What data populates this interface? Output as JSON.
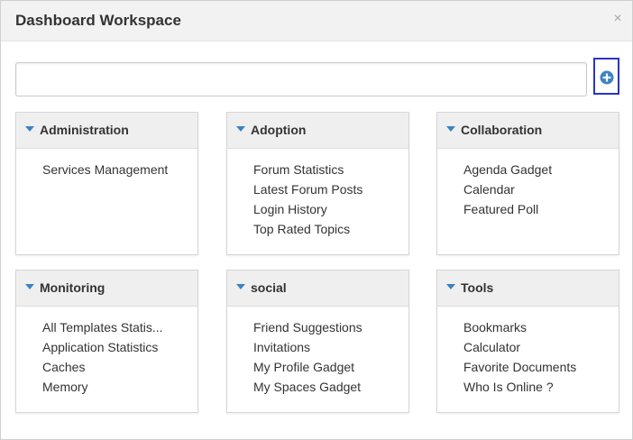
{
  "dialog": {
    "title": "Dashboard Workspace",
    "close_symbol": "×"
  },
  "search": {
    "value": "",
    "placeholder": ""
  },
  "add_button": {
    "icon": "plus-circle-icon",
    "color": "#3d82c4"
  },
  "categories": [
    {
      "title": "Administration",
      "items": [
        "Services Management"
      ]
    },
    {
      "title": "Adoption",
      "items": [
        "Forum Statistics",
        "Latest Forum Posts",
        "Login History",
        "Top Rated Topics"
      ]
    },
    {
      "title": "Collaboration",
      "items": [
        "Agenda Gadget",
        "Calendar",
        "Featured Poll"
      ]
    },
    {
      "title": "Monitoring",
      "items": [
        "All Templates Statis...",
        "Application Statistics",
        "Caches",
        "Memory"
      ]
    },
    {
      "title": "social",
      "items": [
        "Friend Suggestions",
        "Invitations",
        "My Profile Gadget",
        "My Spaces Gadget"
      ]
    },
    {
      "title": "Tools",
      "items": [
        "Bookmarks",
        "Calculator",
        "Favorite Documents",
        "Who Is Online ?"
      ]
    }
  ],
  "colors": {
    "accent": "#3d82c4",
    "focus_border": "#2b34c4"
  }
}
